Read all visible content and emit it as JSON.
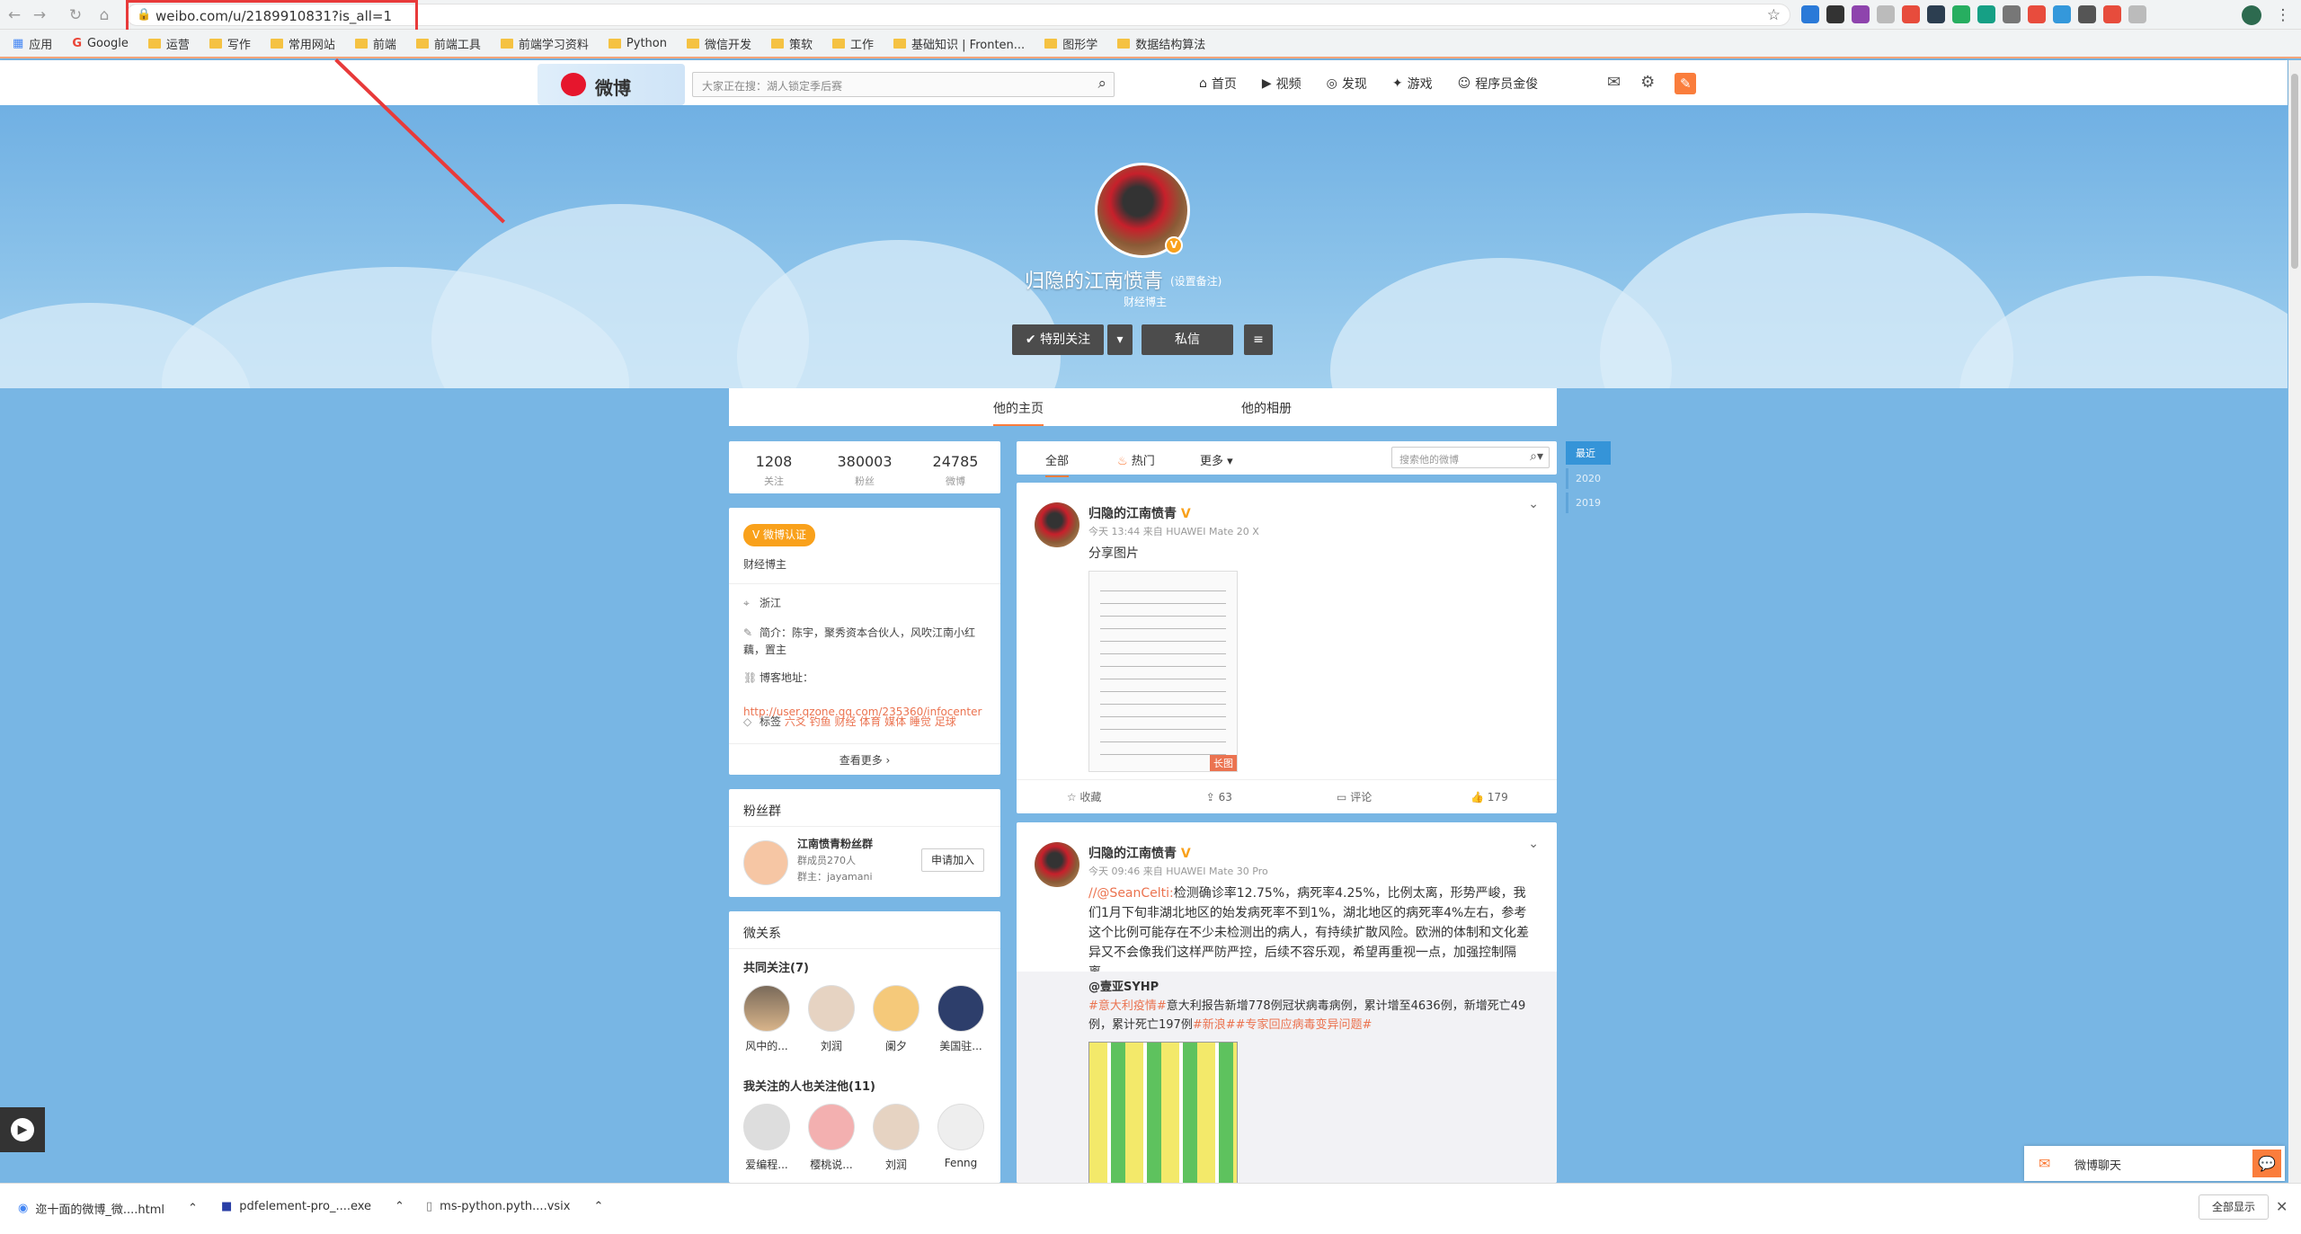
{
  "browser": {
    "url": "weibo.com/u/2189910831?is_all=1",
    "bookmarks": [
      "应用",
      "Google",
      "运营",
      "写作",
      "常用网站",
      "前端",
      "前端工具",
      "前端学习资料",
      "Python",
      "微信开发",
      "策软",
      "工作",
      "基础知识 | Fronten...",
      "图形学",
      "数据结构算法"
    ]
  },
  "weibo_nav": {
    "logo_text": "微博",
    "search_placeholder": "大家正在搜：湖人锁定季后赛",
    "items": [
      "首页",
      "视频",
      "发现",
      "游戏",
      "程序员金俊"
    ]
  },
  "profile": {
    "name": "归隐的江南愤青",
    "note": "(设置备注)",
    "subtitle": "财经博主",
    "buttons": {
      "follow": "特别关注",
      "message": "私信"
    },
    "tabs": [
      "他的主页",
      "他的相册"
    ]
  },
  "stats": [
    {
      "value": "1208",
      "label": "关注"
    },
    {
      "value": "380003",
      "label": "粉丝"
    },
    {
      "value": "24785",
      "label": "微博"
    }
  ],
  "info": {
    "badge": "微博认证",
    "verified_text": "财经博主",
    "location": "浙江",
    "intro": "简介：陈宇，聚秀资本合伙人，风吹江南小红藕，置主",
    "blog_label": "博客地址：",
    "blog_url": "http://user.qzone.qq.com/235360/infocenter",
    "tags_label": "标签",
    "tags": "六爻 钓鱼 财经 体育 媒体 睡觉 足球",
    "more": "查看更多 ›"
  },
  "fan_group": {
    "title": "粉丝群",
    "name": "江南愤青粉丝群",
    "members": "群成员270人",
    "owner": "群主：jayamani",
    "join": "申请加入"
  },
  "relations": {
    "title": "微关系",
    "common_title": "共同关注(7)",
    "common": [
      "风中的...",
      "刘润",
      "阑夕",
      "美国驻..."
    ],
    "followers_title": "我关注的人也关注他(11)",
    "followers": [
      "爱编程...",
      "樱桃说...",
      "刘润",
      "Fenng"
    ]
  },
  "feed_tabs": {
    "all": "全部",
    "hot": "热门",
    "more": "更多",
    "search_placeholder": "搜索他的微博"
  },
  "years": [
    "最近",
    "2020",
    "2019"
  ],
  "posts": [
    {
      "name": "归隐的江南愤青",
      "meta": "今天 13:44 来自 HUAWEI Mate 20 X",
      "text": "分享图片",
      "long_label": "长图",
      "actions": [
        "收藏",
        "63",
        "评论",
        "179"
      ]
    },
    {
      "name": "归隐的江南愤青",
      "meta": "今天 09:46 来自 HUAWEI Mate 30 Pro",
      "mention": "//@SeanCelti:",
      "text": "检测确诊率12.75%，病死率4.25%，比例太离，形势严峻，我们1月下旬非湖北地区的始发病死率不到1%，湖北地区的病死率4%左右，参考这个比例可能存在不少未检测出的病人，有持续扩散风险。欧洲的体制和文化差异又不会像我们这样严防严控，后续不容乐观，希望再重视一点，加强控制隔离。",
      "repost_name": "@壹亚SYHP",
      "repost_tag": "#意大利疫情#",
      "repost_text": "意大利报告新增778例冠状病毒病例，累计增至4636例，新增死亡49例，累计死亡197例",
      "repost_tags2": "#新浪##专家回应病毒变异问题#"
    }
  ],
  "chat": {
    "label": "微博聊天"
  },
  "downloads": [
    "迩十面的微博_微....html",
    "pdfelement-pro_....exe",
    "ms-python.pyth....vsix"
  ],
  "show_all": "全部显示",
  "colors": {
    "accent": "#fa7d3c",
    "weibo_red": "#e6162d",
    "verified": "#f9a11b",
    "cover": "#78b6e4"
  }
}
